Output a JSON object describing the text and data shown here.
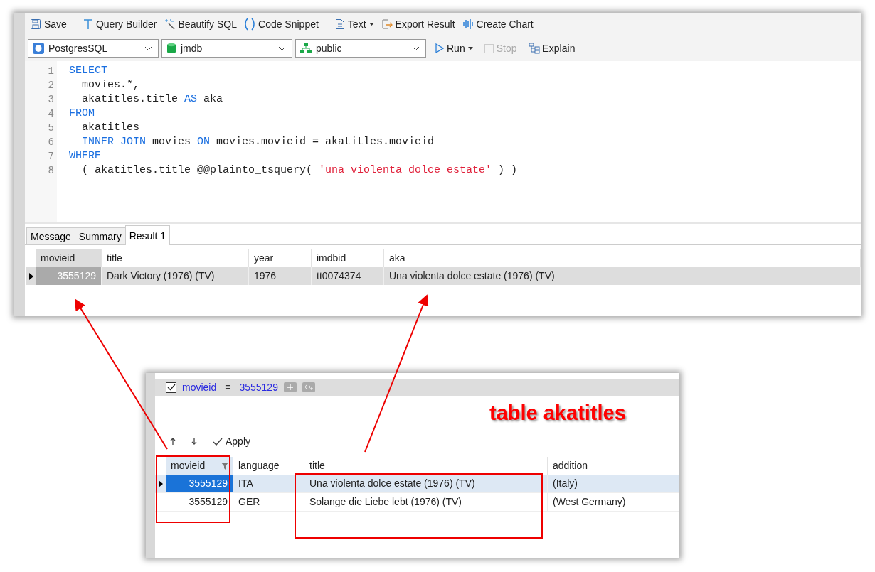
{
  "query_window": {
    "toolbar": [
      {
        "kind": "save",
        "label": "Save"
      },
      {
        "kind": "sep"
      },
      {
        "kind": "builder",
        "label": "Query Builder"
      },
      {
        "kind": "beautify",
        "label": "Beautify SQL"
      },
      {
        "kind": "snippet",
        "label": "Code Snippet"
      },
      {
        "kind": "sep"
      },
      {
        "kind": "text",
        "label": "Text"
      },
      {
        "kind": "export",
        "label": "Export Result"
      },
      {
        "kind": "chart",
        "label": "Create Chart"
      }
    ],
    "selectors": [
      {
        "kind": "connection",
        "value": "PostgresSQL"
      },
      {
        "kind": "database",
        "value": "jmdb"
      },
      {
        "kind": "schema",
        "value": "public"
      }
    ],
    "run": {
      "label": "Run",
      "disabled": false
    },
    "stop": {
      "label": "Stop",
      "disabled": true
    },
    "explain": {
      "label": "Explain",
      "disabled": false
    },
    "code_lines": [
      {
        "number": "1",
        "tokens": [
          {
            "kind": "kw",
            "text": "SELECT"
          }
        ]
      },
      {
        "number": "2",
        "tokens": [
          {
            "kind": "plain",
            "text": "  movies.*,"
          }
        ]
      },
      {
        "number": "3",
        "tokens": [
          {
            "kind": "plain",
            "text": "  akatitles.title "
          },
          {
            "kind": "kw",
            "text": "AS"
          },
          {
            "kind": "plain",
            "text": " aka"
          }
        ]
      },
      {
        "number": "4",
        "tokens": [
          {
            "kind": "kw",
            "text": "FROM"
          }
        ]
      },
      {
        "number": "5",
        "tokens": [
          {
            "kind": "plain",
            "text": "  akatitles"
          }
        ]
      },
      {
        "number": "6",
        "tokens": [
          {
            "kind": "kw",
            "text": "  INNER JOIN"
          },
          {
            "kind": "plain",
            "text": " movies "
          },
          {
            "kind": "kw",
            "text": "ON"
          },
          {
            "kind": "plain",
            "text": " movies.movieid = akatitles.movieid"
          }
        ]
      },
      {
        "number": "7",
        "tokens": [
          {
            "kind": "kw",
            "text": "WHERE"
          }
        ]
      },
      {
        "number": "8",
        "tokens": [
          {
            "kind": "plain",
            "text": "  ( akatitles.title @@plainto_tsquery( "
          },
          {
            "kind": "str",
            "text": "'una violenta dolce estate'"
          },
          {
            "kind": "plain",
            "text": " ) )"
          }
        ]
      }
    ],
    "result_tabs": [
      {
        "label": "Message",
        "selected": false
      },
      {
        "label": "Summary",
        "selected": false
      },
      {
        "label": "Result 1",
        "selected": true
      }
    ],
    "table": {
      "columns": [
        "movieid",
        "title",
        "year",
        "imdbid",
        "aka"
      ],
      "rows": [
        {
          "selected": true,
          "cells": [
            "3555129",
            "Dark Victory (1976) (TV)",
            "1976",
            "tt0074374",
            "Una violenta dolce estate (1976) (TV)"
          ]
        }
      ]
    }
  },
  "table_window": {
    "filter": {
      "checked": true,
      "field": "movieid",
      "operator": "=",
      "value": "3555129"
    },
    "toolbar": [
      {
        "kind": "up"
      },
      {
        "kind": "down"
      },
      {
        "kind": "apply",
        "label": "Apply"
      }
    ],
    "table": {
      "columns": [
        {
          "label": "movieid",
          "filter": true
        },
        {
          "label": "language",
          "filter": false
        },
        {
          "label": "title",
          "filter": false
        },
        {
          "label": "addition",
          "filter": false
        }
      ],
      "rows": [
        {
          "selected": true,
          "cells": [
            "3555129",
            "ITA",
            "Una violenta dolce estate (1976) (TV)",
            "(Italy)"
          ]
        },
        {
          "selected": false,
          "cells": [
            "3555129",
            "GER",
            "Solange die Liebe lebt (1976) (TV)",
            "(West Germany)"
          ]
        }
      ]
    }
  },
  "annotation": {
    "label": "table akatitles"
  }
}
